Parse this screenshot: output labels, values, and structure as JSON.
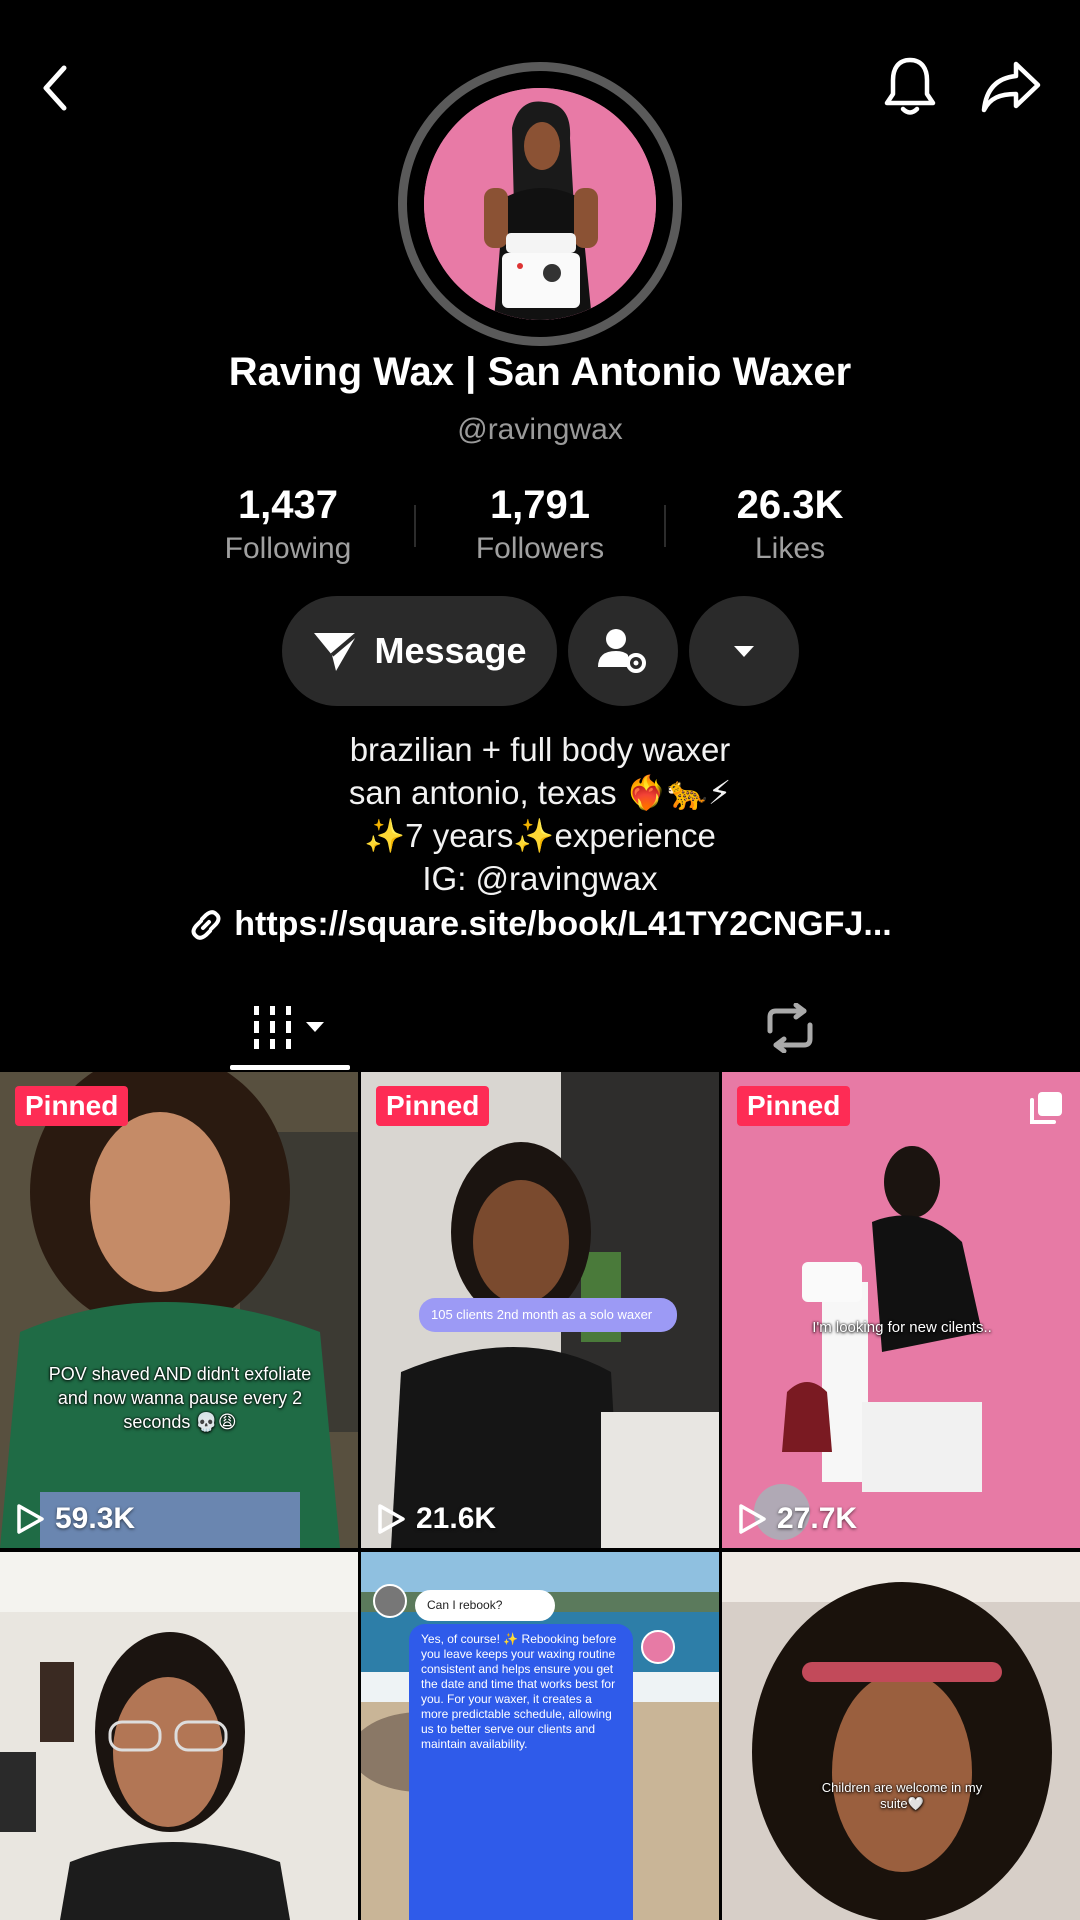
{
  "profile": {
    "display_name": "Raving Wax | San Antonio Waxer",
    "handle": "@ravingwax"
  },
  "stats": [
    {
      "value": "1,437",
      "label": "Following"
    },
    {
      "value": "1,791",
      "label": "Followers"
    },
    {
      "value": "26.3K",
      "label": "Likes"
    }
  ],
  "actions": {
    "message_label": "Message"
  },
  "bio": {
    "lines": [
      "brazilian + full body waxer",
      "san antonio, texas ❤️‍🔥🐆⚡",
      "✨7 years✨experience",
      "IG: @ravingwax"
    ],
    "link": "https://square.site/book/L41TY2CNGFJ..."
  },
  "videos": [
    {
      "pinned": "Pinned",
      "views": "59.3K",
      "caption": "POV shaved AND didn't exfoliate and now wanna pause every 2 seconds 💀😩"
    },
    {
      "pinned": "Pinned",
      "views": "21.6K",
      "caption": "105 clients 2nd month as a solo waxer"
    },
    {
      "pinned": "Pinned",
      "views": "27.7K",
      "caption": "I'm looking for new cilents.."
    },
    {
      "caption": ""
    },
    {
      "chat_question": "Can I rebook?",
      "chat_answer": "Yes, of course! ✨ Rebooking before you leave keeps your waxing routine consistent and helps ensure you get the date and time that works best for you. For your waxer, it creates a more predictable schedule, allowing us to better serve our clients and maintain availability."
    },
    {
      "caption": "Children are welcome in my suite🤍"
    }
  ],
  "colors": {
    "accent_red": "#fe2c55",
    "pill_bg": "#2a2a2a",
    "muted_text": "#a0a0a0"
  },
  "icons": [
    "back-icon",
    "bell-icon",
    "share-icon",
    "send-icon",
    "user-settings-icon",
    "caret-down-icon",
    "link-icon",
    "grid-icon",
    "repost-icon",
    "play-icon",
    "carousel-icon"
  ]
}
